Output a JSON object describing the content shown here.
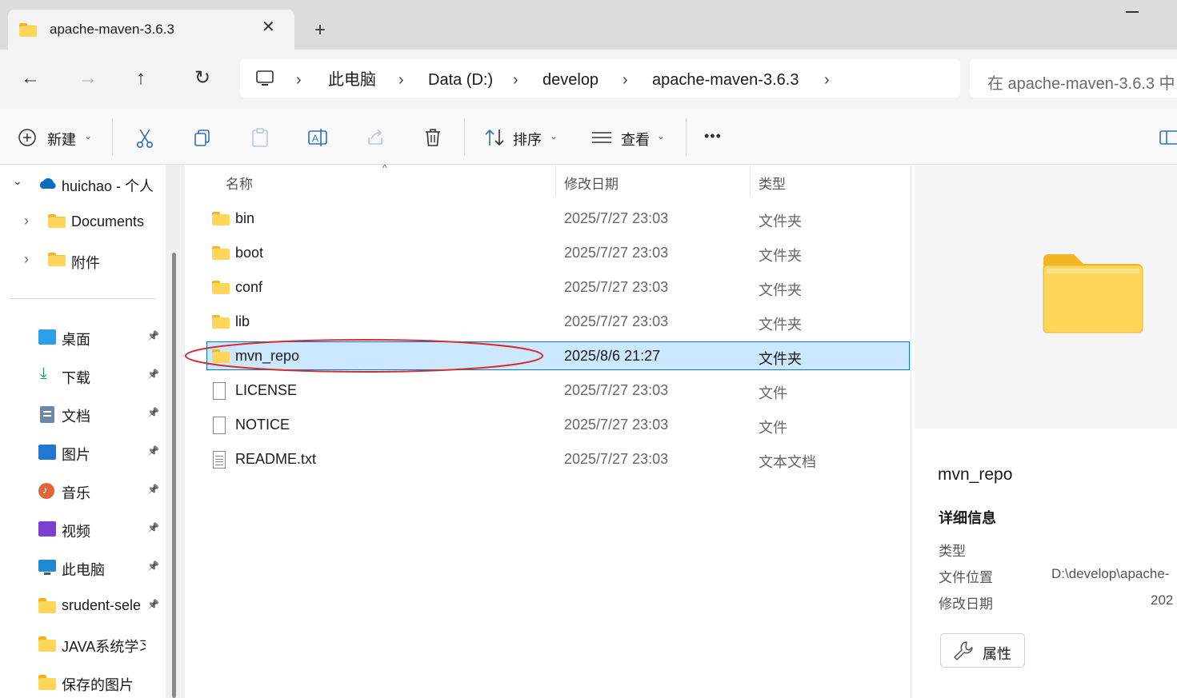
{
  "tab": {
    "title": "apache-maven-3.6.3",
    "close_icon": "close-icon",
    "new_tab": "+"
  },
  "nav": {
    "breadcrumbs": [
      "此电脑",
      "Data (D:)",
      "develop",
      "apache-maven-3.6.3"
    ],
    "search_placeholder": "在 apache-maven-3.6.3 中"
  },
  "toolbar": {
    "new_label": "新建",
    "sort_label": "排序",
    "view_label": "查看",
    "more": "•••"
  },
  "sidebar": {
    "onedrive": {
      "label": "huichao - 个人"
    },
    "onedrive_children": [
      {
        "label": "Documents"
      },
      {
        "label": "附件"
      }
    ],
    "quick_access": [
      {
        "label": "桌面",
        "icon": "desktop-icon",
        "color": "#2aa0e6"
      },
      {
        "label": "下载",
        "icon": "download-icon",
        "color": "#1a9e5a"
      },
      {
        "label": "文档",
        "icon": "documents-icon",
        "color": "#6e87a8"
      },
      {
        "label": "图片",
        "icon": "pictures-icon",
        "color": "#1f78d1"
      },
      {
        "label": "音乐",
        "icon": "music-icon",
        "color": "#e0663a"
      },
      {
        "label": "视频",
        "icon": "videos-icon",
        "color": "#7b3fd1"
      },
      {
        "label": "此电脑",
        "icon": "this-pc-icon",
        "color": "#1f8ad1"
      },
      {
        "label": "srudent-sele",
        "icon": "folder-icon",
        "color": "#f2b623"
      },
      {
        "label": "JAVA系统学习",
        "icon": "folder-icon",
        "color": "#f2b623"
      },
      {
        "label": "保存的图片",
        "icon": "folder-icon",
        "color": "#f2b623"
      }
    ]
  },
  "file_list": {
    "columns": {
      "name": "名称",
      "date": "修改日期",
      "type": "类型"
    },
    "rows": [
      {
        "name": "bin",
        "date": "2025/7/27 23:03",
        "type": "文件夹"
      },
      {
        "name": "boot",
        "date": "2025/7/27 23:03",
        "type": "文件夹"
      },
      {
        "name": "conf",
        "date": "2025/7/27 23:03",
        "type": "文件夹"
      },
      {
        "name": "lib",
        "date": "2025/7/27 23:03",
        "type": "文件夹"
      },
      {
        "name": "mvn_repo",
        "date": "2025/8/6 21:27",
        "type": "文件夹"
      },
      {
        "name": "LICENSE",
        "date": "2025/7/27 23:03",
        "type": "文件"
      },
      {
        "name": "NOTICE",
        "date": "2025/7/27 23:03",
        "type": "文件"
      },
      {
        "name": "README.txt",
        "date": "2025/7/27 23:03",
        "type": "文本文档"
      }
    ]
  },
  "details": {
    "title": "mvn_repo",
    "heading": "详细信息",
    "type_label": "类型",
    "location_label": "文件位置",
    "location_value": "D:\\develop\\apache-",
    "modified_label": "修改日期",
    "modified_value": "202",
    "properties_label": "属性"
  }
}
